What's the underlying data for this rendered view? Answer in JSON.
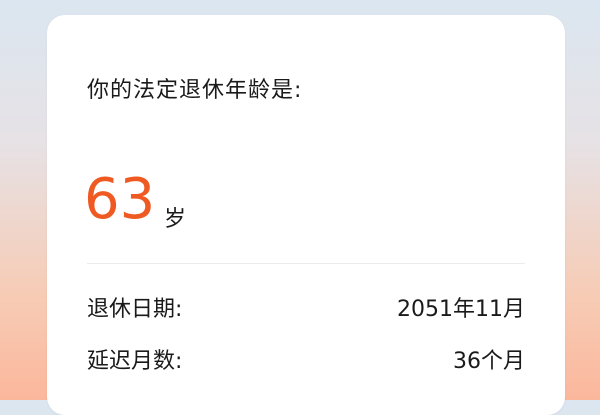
{
  "result": {
    "title": "你的法定退休年龄是:",
    "age_value": "63",
    "age_unit": "岁",
    "rows": [
      {
        "label": "退休日期:",
        "value": "2051年11月"
      },
      {
        "label": "延迟月数:",
        "value": "36个月"
      }
    ]
  },
  "colors": {
    "accent": "#ef5a23",
    "card_bg": "#ffffff",
    "text": "#1a1a1a"
  },
  "icons": [
    "envelope-decoration-icon"
  ]
}
